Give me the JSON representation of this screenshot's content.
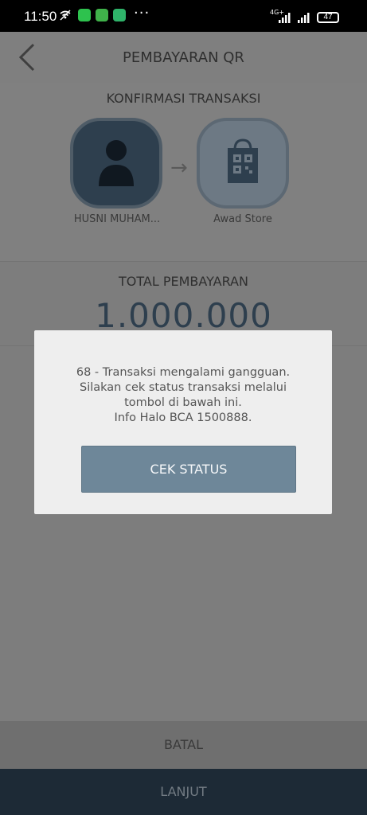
{
  "status_bar": {
    "time": "11:50",
    "network": "4G+",
    "battery": "47",
    "more": "···",
    "notification_icons": [
      "wifi-call-icon",
      "whatsapp-icon",
      "chat-app-icon",
      "app-icon"
    ]
  },
  "header": {
    "title": "PEMBAYARAN QR",
    "back_icon": "chevron-left-icon"
  },
  "transaction": {
    "section_title": "KONFIRMASI TRANSAKSI",
    "sender_name": "HUSNI MUHAM...",
    "receiver_name": "Awad Store",
    "arrow": "→",
    "total_label": "TOTAL PEMBAYARAN",
    "total_amount": "1.000.000"
  },
  "dialog": {
    "message_lines": [
      "68 - Transaksi mengalami gangguan.",
      "Silakan cek status transaksi melalui",
      "tombol di bawah ini.",
      "Info Halo BCA 1500888."
    ],
    "button_label": "CEK STATUS"
  },
  "footer": {
    "cancel_label": "BATAL",
    "next_label": "LANJUT"
  },
  "colors": {
    "dialog_button": "#6e8799",
    "next_bar": "#1d2a36",
    "overlay": "#7d7d7d",
    "brand_dark": "#2e3f4e"
  }
}
